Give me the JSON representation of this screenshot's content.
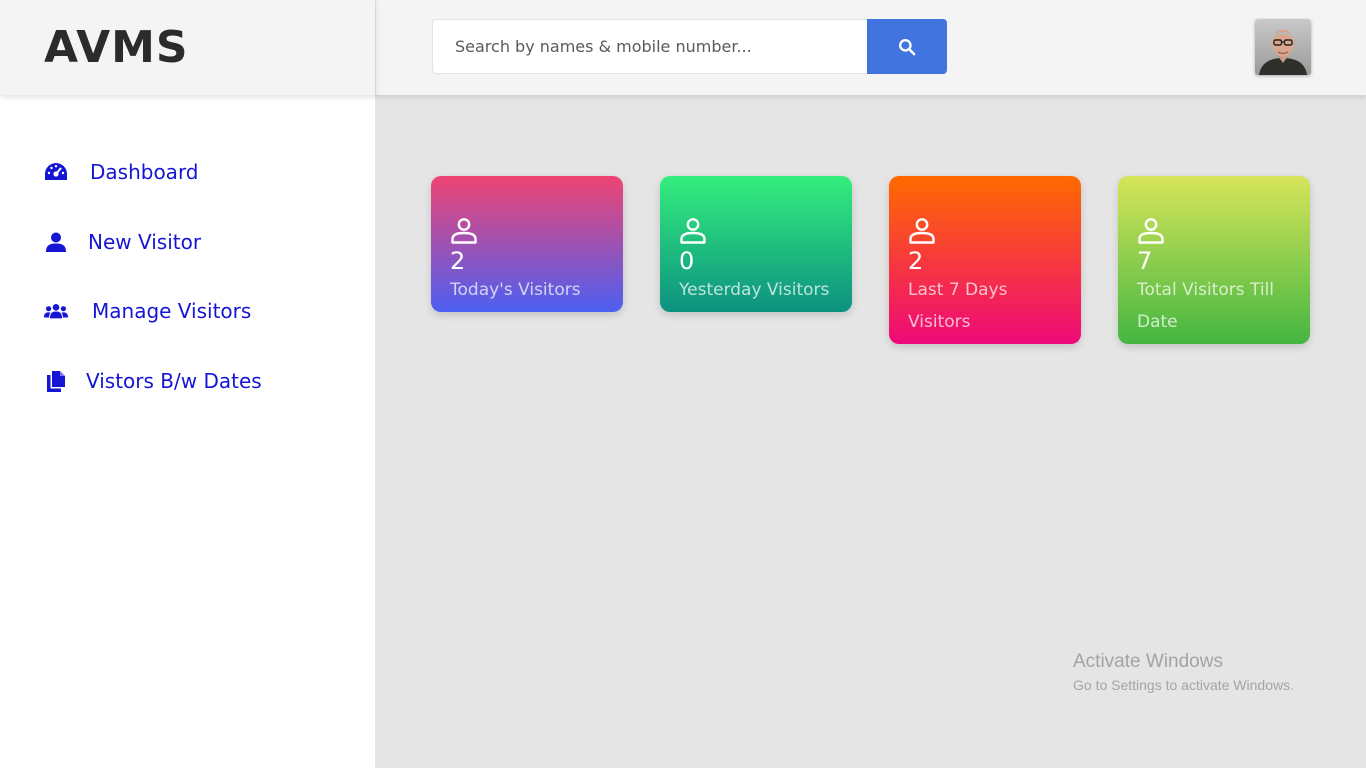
{
  "app": {
    "logo": "AVMS"
  },
  "search": {
    "placeholder": "Search by names & mobile number...",
    "icon": "search-icon"
  },
  "user": {
    "avatar": "user-avatar-photo"
  },
  "sidebar": {
    "items": [
      {
        "label": "Dashboard",
        "icon": "dashboard-gauge-icon"
      },
      {
        "label": "New Visitor",
        "icon": "user-icon"
      },
      {
        "label": "Manage Visitors",
        "icon": "users-group-icon"
      },
      {
        "label": "Vistors B/w Dates",
        "icon": "files-icon"
      }
    ]
  },
  "cards": [
    {
      "value": "2",
      "label": "Today's Visitors",
      "icon": "user-outline-icon",
      "gradient": [
        "#ef4472",
        "#4c60f2"
      ]
    },
    {
      "value": "0",
      "label": "Yesterday Visitors",
      "icon": "user-outline-icon",
      "gradient": [
        "#34ee7d",
        "#0d9180"
      ]
    },
    {
      "value": "2",
      "label": "Last 7 Days Visitors",
      "icon": "user-outline-icon",
      "gradient": [
        "#ff6a00",
        "#ee0979"
      ]
    },
    {
      "value": "7",
      "label": "Total Visitors Till Date",
      "icon": "user-outline-icon",
      "gradient": [
        "#d7e55a",
        "#44b641"
      ]
    }
  ],
  "watermark": {
    "title": "Activate Windows",
    "subtitle": "Go to Settings to activate Windows."
  },
  "colors": {
    "accent": "#4274e0",
    "nav_text": "#1515d4",
    "logo_text": "#2b2b2b"
  }
}
